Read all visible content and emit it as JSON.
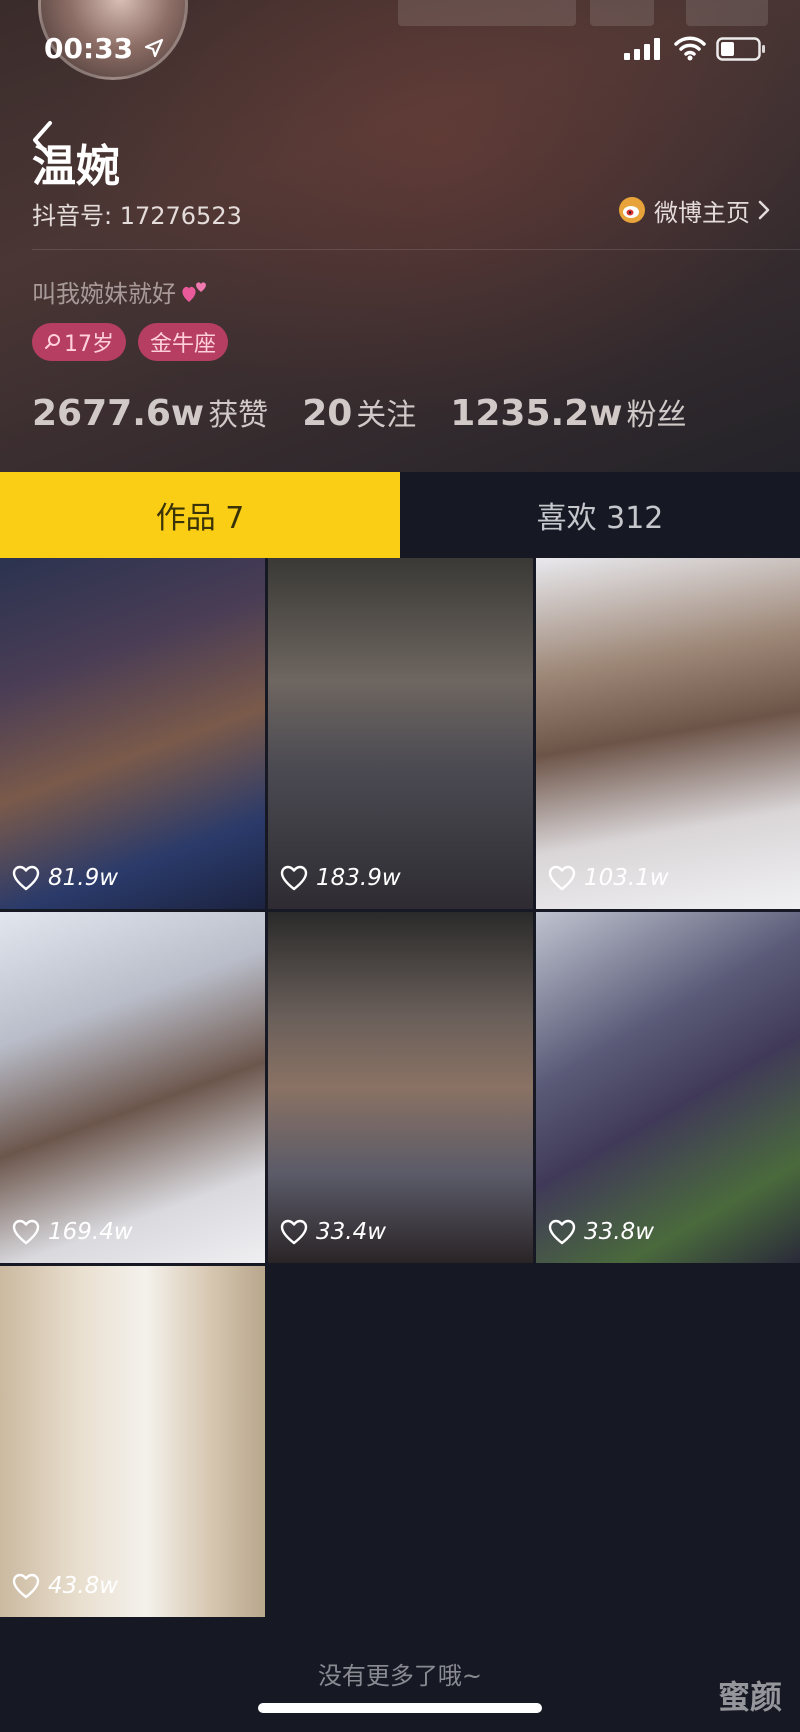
{
  "status_bar": {
    "time": "00:33"
  },
  "profile": {
    "nickname": "温婉",
    "douyin_id": "抖音号: 17276523",
    "weibo_label": "微博主页",
    "bio": "叫我婉妹就好",
    "tags": [
      "17岁",
      "金牛座"
    ],
    "stats": [
      {
        "value": "2677.6w",
        "label": "获赞"
      },
      {
        "value": "20",
        "label": "关注"
      },
      {
        "value": "1235.2w",
        "label": "粉丝"
      }
    ]
  },
  "tabs": [
    {
      "label": "作品 7",
      "active": true
    },
    {
      "label": "喜欢 312",
      "active": false
    }
  ],
  "videos": [
    {
      "likes": "81.9w"
    },
    {
      "likes": "183.9w"
    },
    {
      "likes": "103.1w"
    },
    {
      "likes": "169.4w"
    },
    {
      "likes": "33.4w"
    },
    {
      "likes": "33.8w"
    },
    {
      "likes": "43.8w"
    }
  ],
  "footer": {
    "no_more": "没有更多了哦~",
    "watermark": "蜜颜"
  },
  "colors": {
    "accent_yellow": "#face15",
    "tag_pink": "#b63e63",
    "background": "#161823"
  }
}
